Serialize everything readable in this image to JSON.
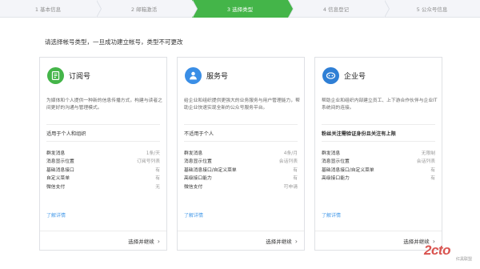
{
  "steps": [
    {
      "label": "1 基本信息",
      "active": false
    },
    {
      "label": "2 邮箱激活",
      "active": false
    },
    {
      "label": "3 选择类型",
      "active": true
    },
    {
      "label": "4 信息登记",
      "active": false
    },
    {
      "label": "5 公众号信息",
      "active": false
    }
  ],
  "intro": "请选择帐号类型，一旦成功建立帐号，类型不可更改",
  "cards": [
    {
      "title": "订阅号",
      "icon": "subscription-icon",
      "desc": "为媒体和个人提供一种新的信息传播方式，构建与读者之间更好的沟通与管理模式。",
      "scope": "适用于个人和组织",
      "features": [
        {
          "name": "群发消息",
          "value": "1条/天"
        },
        {
          "name": "消息显示位置",
          "value": "订阅号列表"
        },
        {
          "name": "基础消息接口",
          "value": "有"
        },
        {
          "name": "自定义菜单",
          "value": "有"
        },
        {
          "name": "微信支付",
          "value": "无"
        }
      ],
      "more": "了解详情",
      "select": "选择并继续"
    },
    {
      "title": "服务号",
      "icon": "service-icon",
      "desc": "给企业和组织提供更强大的业务服务与用户管理能力，帮助企业快速实现全新的公众号服务平台。",
      "scope": "不适用于个人",
      "features": [
        {
          "name": "群发消息",
          "value": "4条/月"
        },
        {
          "name": "消息显示位置",
          "value": "会话列表"
        },
        {
          "name": "基础消息接口/自定义菜单",
          "value": "有"
        },
        {
          "name": "高级接口能力",
          "value": "有"
        },
        {
          "name": "微信支付",
          "value": "可申请"
        }
      ],
      "more": "了解详情",
      "select": "选择并继续"
    },
    {
      "title": "企业号",
      "icon": "enterprise-icon",
      "desc": "帮助企业和组织内部建立员工、上下游合作伙伴与企业IT系统间的连接。",
      "scope": "粉丝关注需验证身份且关注有上限",
      "features": [
        {
          "name": "群发消息",
          "value": "无限制"
        },
        {
          "name": "消息显示位置",
          "value": "会话列表"
        },
        {
          "name": "基础消息接口/自定义菜单",
          "value": "有"
        },
        {
          "name": "高级接口能力",
          "value": "有"
        }
      ],
      "more": "了解详情",
      "select": "选择并继续"
    }
  ],
  "watermark": {
    "logo": "2cto",
    "sub": "红黑联盟"
  }
}
